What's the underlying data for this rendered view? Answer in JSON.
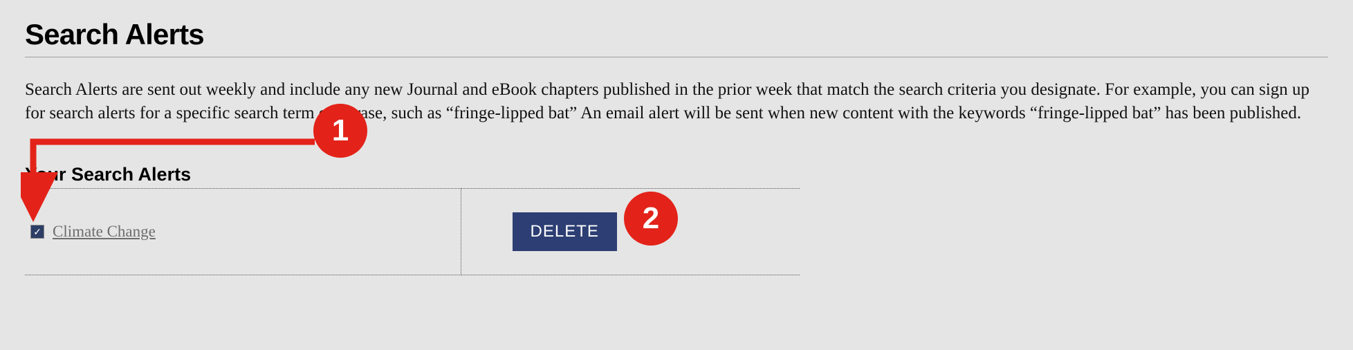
{
  "page": {
    "title": "Search Alerts",
    "description": "Search Alerts are sent out weekly and include any new Journal and eBook chapters published in the prior week that match the search criteria you designate. For example, you can sign up for search alerts for a specific search term or phrase, such as “fringe-lipped bat” An email alert will be sent when new content with the keywords “fringe-lipped bat” has been published."
  },
  "section": {
    "heading": "Your Search Alerts"
  },
  "alerts": {
    "items": [
      {
        "label": "Climate Change",
        "checked": true
      }
    ],
    "delete_label": "DELETE"
  },
  "annotations": {
    "badge1": "1",
    "badge2": "2"
  }
}
